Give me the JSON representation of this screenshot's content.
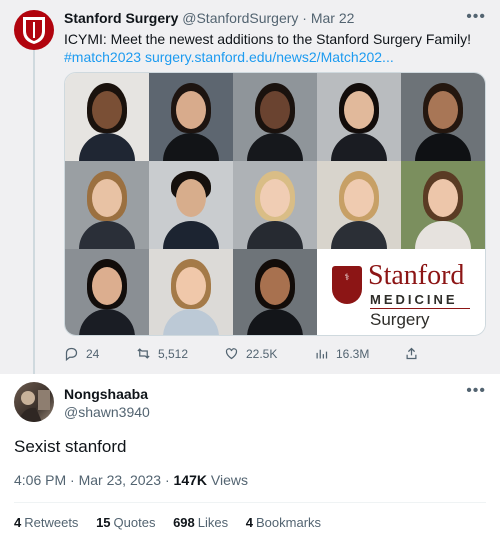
{
  "quoted_tweet": {
    "author_name": "Stanford Surgery",
    "author_handle": "@StanfordSurgery",
    "separator": "·",
    "date": "Mar 22",
    "text": "ICYMI: Meet the newest additions to the Stanford Surgery Family!",
    "hashtag": "#match2023",
    "link": "surgery.stanford.edu/news2/Match202...",
    "more_icon": "more-horizontal-icon",
    "media": {
      "logo_name": "Stanford",
      "logo_department": "MEDICINE",
      "logo_unit": "Surgery"
    },
    "actions": {
      "replies": "24",
      "retweets": "5,512",
      "likes": "22.5K",
      "views": "16.3M"
    }
  },
  "reply": {
    "author_name": "Nongshaaba",
    "author_handle": "@shawn3940",
    "text": "Sexist stanford",
    "time": "4:06 PM",
    "date": "Mar 23, 2023",
    "views_count": "147K",
    "views_label": "Views",
    "stats": [
      {
        "count": "4",
        "label": "Retweets"
      },
      {
        "count": "15",
        "label": "Quotes"
      },
      {
        "count": "698",
        "label": "Likes"
      },
      {
        "count": "4",
        "label": "Bookmarks"
      }
    ]
  },
  "colors": {
    "brand_red": "#8c1515",
    "link_blue": "#1d9bf0",
    "muted_text": "#536471"
  }
}
